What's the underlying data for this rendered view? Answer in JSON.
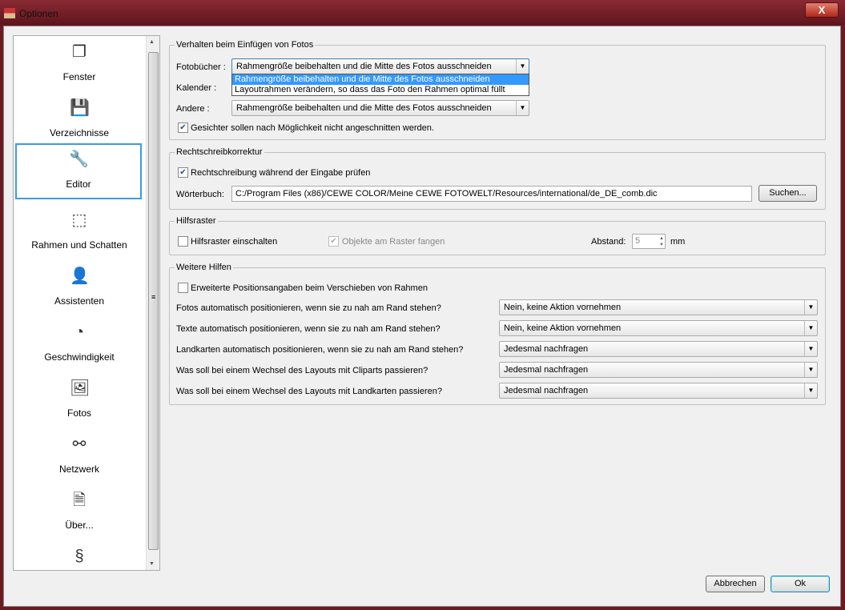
{
  "window": {
    "title": "Optionen",
    "close": "X"
  },
  "sidebar": {
    "items": [
      {
        "label": "Fenster",
        "icon": "window-icon",
        "glyph": "❐"
      },
      {
        "label": "Verzeichnisse",
        "icon": "floppy-disk-icon",
        "glyph": "💾"
      },
      {
        "label": "Editor",
        "icon": "wrench-icon",
        "glyph": "🔧"
      },
      {
        "label": "Rahmen und Schatten",
        "icon": "frame-icon",
        "glyph": "⬚"
      },
      {
        "label": "Assistenten",
        "icon": "assistant-avatar-icon",
        "glyph": "👤"
      },
      {
        "label": "Geschwindigkeit",
        "icon": "speedometer-icon",
        "glyph": "◔"
      },
      {
        "label": "Fotos",
        "icon": "photos-icon",
        "glyph": "🖼"
      },
      {
        "label": "Netzwerk",
        "icon": "network-icon",
        "glyph": "⚯"
      },
      {
        "label": "Über...",
        "icon": "info-document-icon",
        "glyph": "🗎"
      },
      {
        "label": "",
        "icon": "legal-document-icon",
        "glyph": "§"
      }
    ]
  },
  "photos": {
    "legend": "Verhalten beim Einfügen von Fotos",
    "fotobuecher_label": "Fotobücher :",
    "fotobuecher_value": "Rahmengröße beibehalten und die Mitte des Fotos ausschneiden",
    "options": [
      "Rahmengröße beibehalten und die Mitte des Fotos ausschneiden",
      "Layoutrahmen verändern, so dass das Foto den Rahmen optimal füllt"
    ],
    "kalender_label": "Kalender :",
    "andere_label": "Andere :",
    "andere_value": "Rahmengröße beibehalten und die Mitte des Fotos ausschneiden",
    "faces_label": "Gesichter sollen nach Möglichkeit nicht angeschnitten werden.",
    "faces_checked": true
  },
  "spell": {
    "legend": "Rechtschreibkorrektur",
    "check_label": "Rechtschreibung während der Eingabe prüfen",
    "checked": true,
    "dict_label": "Wörterbuch:",
    "dict_value": "C:/Program Files (x86)/CEWE COLOR/Meine CEWE FOTOWELT/Resources/international/de_DE_comb.dic",
    "search_button": "Suchen..."
  },
  "grid": {
    "legend": "Hilfsraster",
    "enable_label": "Hilfsraster einschalten",
    "enabled": false,
    "snap_label": "Objekte am Raster fangen",
    "snap": true,
    "spacing_label": "Abstand:",
    "spacing_value": "5",
    "unit": "mm"
  },
  "help": {
    "legend": "Weitere Hilfen",
    "ext_label": "Erweiterte Positionsangaben beim Verschieben von Rahmen",
    "ext_checked": false,
    "rows": [
      {
        "label": "Fotos automatisch positionieren, wenn sie zu nah am Rand stehen?",
        "value": "Nein, keine Aktion vornehmen"
      },
      {
        "label": "Texte automatisch positionieren, wenn sie zu nah am Rand stehen?",
        "value": "Nein, keine Aktion vornehmen"
      },
      {
        "label": "Landkarten automatisch positionieren, wenn sie zu nah am Rand stehen?",
        "value": "Jedesmal nachfragen"
      },
      {
        "label": "Was soll bei einem Wechsel des Layouts mit Cliparts passieren?",
        "value": "Jedesmal nachfragen"
      },
      {
        "label": "Was soll bei einem Wechsel des Layouts mit Landkarten passieren?",
        "value": "Jedesmal nachfragen"
      }
    ]
  },
  "buttons": {
    "cancel": "Abbrechen",
    "ok": "Ok"
  }
}
